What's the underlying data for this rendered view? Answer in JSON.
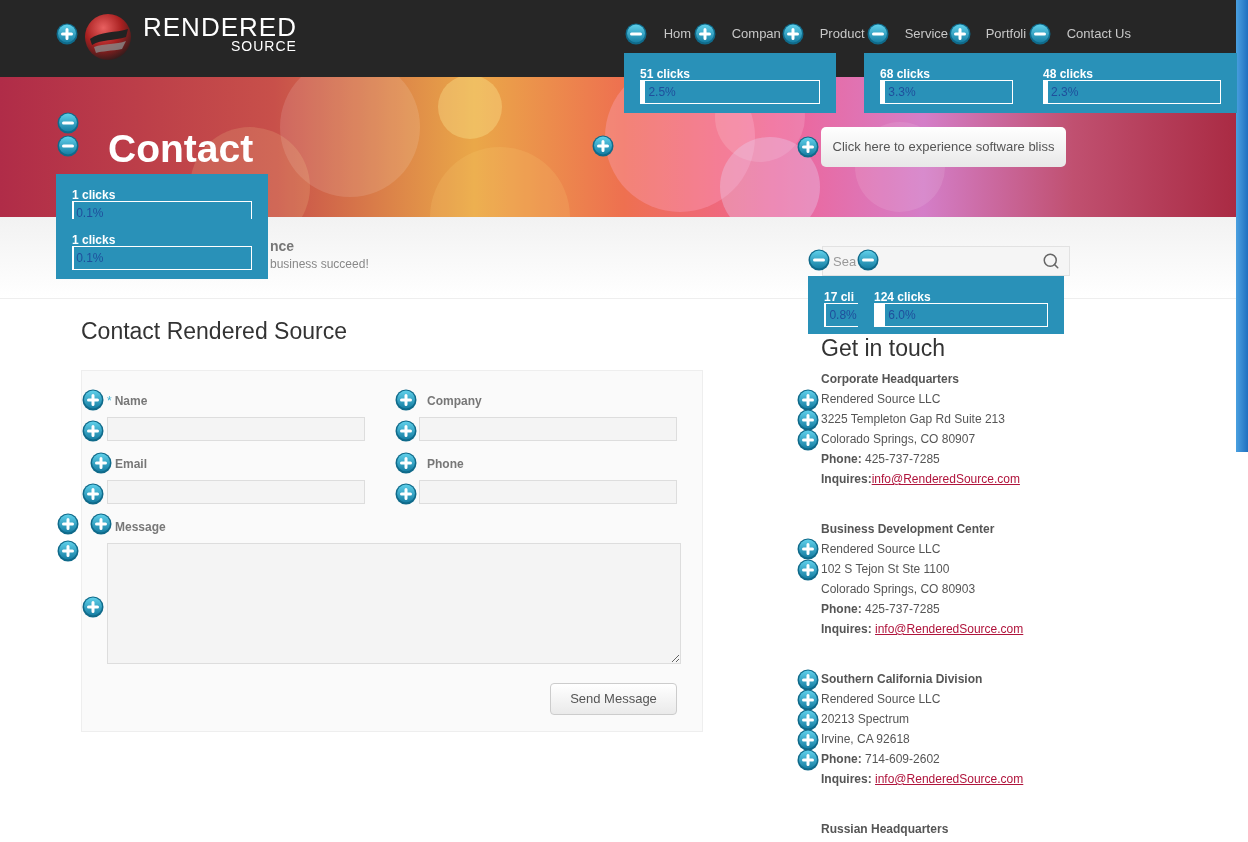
{
  "header": {
    "logo": {
      "line_1": "RENDERED",
      "line_2": "SOURCE"
    },
    "nav": [
      {
        "label": "Hom"
      },
      {
        "label": "Compan"
      },
      {
        "label": "Product"
      },
      {
        "label": "Service"
      },
      {
        "label": "Portfoli"
      },
      {
        "label": "Contact Us"
      }
    ]
  },
  "banner": {
    "title": "Contact",
    "cta": "Click here to experience software bliss"
  },
  "tagline": {
    "heading": "nce",
    "text": "business succeed!"
  },
  "search": {
    "placeholder": "Sea"
  },
  "form": {
    "title": "Contact Rendered Source",
    "fields": [
      {
        "kind": "text",
        "label": "Name",
        "required_mark": "*"
      },
      {
        "kind": "text",
        "label": "Company"
      },
      {
        "kind": "text",
        "label": "Email"
      },
      {
        "kind": "text",
        "label": "Phone"
      },
      {
        "kind": "textarea",
        "label": "Message"
      }
    ],
    "submit": "Send Message"
  },
  "contact": {
    "title": "Get in touch",
    "locations": [
      {
        "title": "Corporate Headquarters",
        "lines": [
          "Rendered Source LLC",
          "3225 Templeton Gap Rd Suite 213",
          "Colorado Springs, CO 80907",
          "**Phone:** 425-737-7285"
        ],
        "inquiries_label": "Inquires:",
        "email": "info@RenderedSource.com"
      },
      {
        "title": "Business Development Center",
        "lines": [
          "Rendered Source LLC",
          "102 S Tejon St Ste 1100",
          "Colorado Springs, CO 80903",
          "**Phone:** 425-737-7285"
        ],
        "inquiries_label": "Inquires: ",
        "email": "info@RenderedSource.com"
      },
      {
        "title": "Southern California Division",
        "lines": [
          "Rendered Source LLC",
          "20213 Spectrum",
          "Irvine, CA 92618",
          "**Phone:** 714-609-2602"
        ],
        "inquiries_label": "Inquires: ",
        "email": "info@RenderedSource.com"
      },
      {
        "title": "Russian Headquarters"
      }
    ]
  },
  "heatmap": {
    "popups": [
      {
        "clicks": "51 clicks",
        "percent": "2.5%",
        "level": 0.025
      },
      {
        "clicks": "68 clicks",
        "percent": "3.3%",
        "level": 0.033
      },
      {
        "clicks": "48 clicks",
        "percent": "2.3%",
        "level": 0.023
      },
      {
        "clicks": "1 clicks",
        "percent": "0.1%",
        "level": 0.001
      },
      {
        "clicks": "1 clicks",
        "percent": "0.1%",
        "level": 0.001
      },
      {
        "clicks": "17 cli",
        "percent": "0.8%",
        "level": 0.008
      },
      {
        "clicks": "124 clicks",
        "percent": "6.0%",
        "level": 0.06
      }
    ],
    "markers": [
      {
        "kind": "plus"
      },
      {
        "kind": "minus"
      },
      {
        "kind": "plus"
      },
      {
        "kind": "plus"
      },
      {
        "kind": "minus"
      },
      {
        "kind": "plus"
      },
      {
        "kind": "minus"
      },
      {
        "kind": "minus"
      },
      {
        "kind": "minus"
      },
      {
        "kind": "plus"
      },
      {
        "kind": "plus"
      },
      {
        "kind": "minus"
      },
      {
        "kind": "minus"
      },
      {
        "kind": "plus"
      },
      {
        "kind": "plus"
      },
      {
        "kind": "plus"
      },
      {
        "kind": "plus"
      },
      {
        "kind": "plus"
      },
      {
        "kind": "plus"
      },
      {
        "kind": "plus"
      },
      {
        "kind": "plus"
      },
      {
        "kind": "plus"
      },
      {
        "kind": "plus"
      },
      {
        "kind": "plus"
      },
      {
        "kind": "plus"
      },
      {
        "kind": "plus"
      },
      {
        "kind": "plus"
      },
      {
        "kind": "plus"
      },
      {
        "kind": "plus"
      },
      {
        "kind": "plus"
      },
      {
        "kind": "plus"
      },
      {
        "kind": "plus"
      },
      {
        "kind": "plus"
      },
      {
        "kind": "plus"
      },
      {
        "kind": "plus"
      }
    ]
  }
}
